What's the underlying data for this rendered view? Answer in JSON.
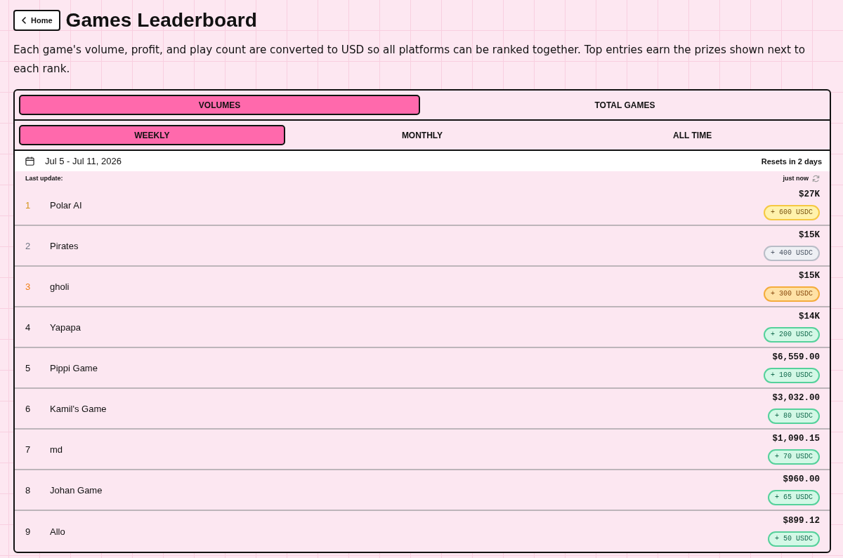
{
  "back_button": {
    "label": "Home"
  },
  "title": "Games Leaderboard",
  "description": "Each game's volume, profit, and play count are converted to USD so all platforms can be ranked together. Top entries earn the prizes shown next to each rank.",
  "metric_tabs": [
    {
      "label": "VOLUMES",
      "selected": true
    },
    {
      "label": "TOTAL GAMES",
      "selected": false
    }
  ],
  "period_tabs": [
    {
      "label": "WEEKLY",
      "selected": true
    },
    {
      "label": "MONTHLY",
      "selected": false
    },
    {
      "label": "ALL TIME",
      "selected": false
    }
  ],
  "date_range": "Jul 5 - Jul 11, 2026",
  "reset_note": "Resets in 2 days",
  "last_update": {
    "label": "Last update:",
    "value": "just now"
  },
  "rows": [
    {
      "rank": "1",
      "name": "Polar AI",
      "amount": "$27K",
      "prize": "+ 600 USDC",
      "kind": "gold"
    },
    {
      "rank": "2",
      "name": "Pirates",
      "amount": "$15K",
      "prize": "+ 400 USDC",
      "kind": "silver"
    },
    {
      "rank": "3",
      "name": "gholi",
      "amount": "$15K",
      "prize": "+ 300 USDC",
      "kind": "bronze"
    },
    {
      "rank": "4",
      "name": "Yapapa",
      "amount": "$14K",
      "prize": "+ 200 USDC",
      "kind": "standard"
    },
    {
      "rank": "5",
      "name": "Pippi Game",
      "amount": "$6,559.00",
      "prize": "+ 100 USDC",
      "kind": "standard"
    },
    {
      "rank": "6",
      "name": "Kamil's Game",
      "amount": "$3,032.00",
      "prize": "+ 80 USDC",
      "kind": "standard"
    },
    {
      "rank": "7",
      "name": "md",
      "amount": "$1,090.15",
      "prize": "+ 70 USDC",
      "kind": "standard"
    },
    {
      "rank": "8",
      "name": "Johan Game",
      "amount": "$960.00",
      "prize": "+ 65 USDC",
      "kind": "standard"
    },
    {
      "rank": "9",
      "name": "Allo",
      "amount": "$899.12",
      "prize": "+ 50 USDC",
      "kind": "standard"
    }
  ]
}
